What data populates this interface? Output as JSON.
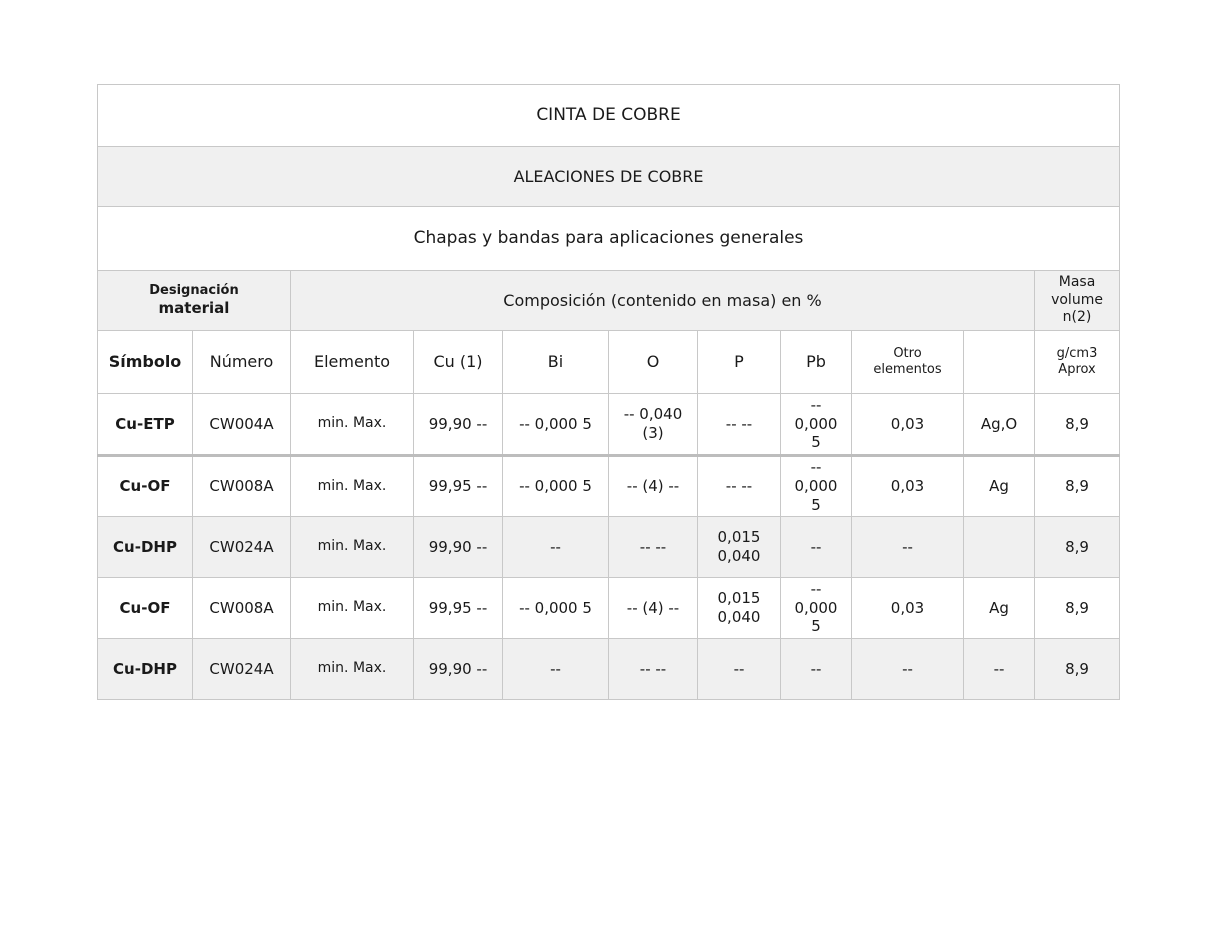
{
  "title": "CINTA DE COBRE",
  "subtitle": "ALEACIONES DE COBRE",
  "application": "Chapas y bandas para aplicaciones generales",
  "header": {
    "designation_line1": "Designación",
    "designation_line2": "material",
    "composition": "Composición (contenido en masa) en %",
    "mass_line1": "Masa",
    "mass_line2": "volume",
    "mass_line3": "n(2)"
  },
  "columns": {
    "symbol": "Símbolo",
    "number": "Número",
    "element": "Elemento",
    "cu": "Cu (1)",
    "bi": "Bi",
    "o": "O",
    "p": "P",
    "pb": "Pb",
    "other_line1": "Otro",
    "other_line2": "elementos",
    "extra": "",
    "unit_line1": "g/cm3",
    "unit_line2": "Aprox"
  },
  "rows": [
    {
      "symbol": "Cu-ETP",
      "number": "CW004A",
      "element": "min. Max.",
      "cu": "99,90 --",
      "bi": "-- 0,000 5",
      "o_line1": "-- 0,040",
      "o_line2": "(3)",
      "p_line1": "-- --",
      "p_line2": "",
      "pb_line1": "--",
      "pb_line2": "0,000",
      "pb_line3": "5",
      "other": "0,03",
      "extra": "Ag,O",
      "density": "8,9"
    },
    {
      "symbol": "Cu-OF",
      "number": "CW008A",
      "element": "min. Max.",
      "cu": "99,95 --",
      "bi": "-- 0,000 5",
      "o_line1": "-- (4) --",
      "o_line2": "",
      "p_line1": "-- --",
      "p_line2": "",
      "pb_line1": "--",
      "pb_line2": "0,000",
      "pb_line3": "5",
      "other": "0,03",
      "extra": "Ag",
      "density": "8,9"
    },
    {
      "symbol": "Cu-DHP",
      "number": "CW024A",
      "element": "min. Max.",
      "cu": "99,90 --",
      "bi": "--",
      "o_line1": "-- --",
      "o_line2": "",
      "p_line1": "0,015",
      "p_line2": "0,040",
      "pb_line1": "--",
      "pb_line2": "",
      "pb_line3": "",
      "other": "--",
      "extra": "",
      "density": "8,9"
    },
    {
      "symbol": "Cu-OF",
      "number": "CW008A",
      "element": "min. Max.",
      "cu": "99,95 --",
      "bi": "-- 0,000 5",
      "o_line1": "-- (4) --",
      "o_line2": "",
      "p_line1": "0,015",
      "p_line2": "0,040",
      "pb_line1": "--",
      "pb_line2": "0,000",
      "pb_line3": "5",
      "other": "0,03",
      "extra": "Ag",
      "density": "8,9"
    },
    {
      "symbol": "Cu-DHP",
      "number": "CW024A",
      "element": "min. Max.",
      "cu": "99,90 --",
      "bi": "--",
      "o_line1": "-- --",
      "o_line2": "",
      "p_line1": "--",
      "p_line2": "",
      "pb_line1": "--",
      "pb_line2": "",
      "pb_line3": "",
      "other": "--",
      "extra": "--",
      "density": "8,9"
    }
  ]
}
